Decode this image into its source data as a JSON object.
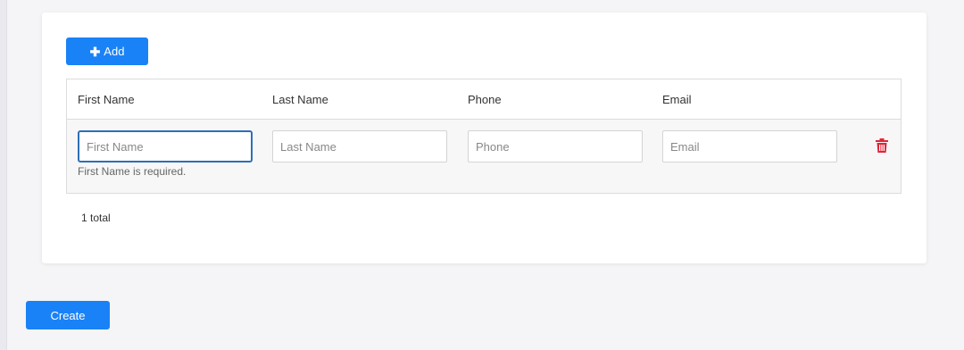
{
  "toolbar": {
    "add_label": "Add"
  },
  "table": {
    "columns": [
      "First Name",
      "Last Name",
      "Phone",
      "Email"
    ],
    "row": {
      "first_name": {
        "value": "",
        "placeholder": "First Name",
        "error": "First Name is required."
      },
      "last_name": {
        "value": "",
        "placeholder": "Last Name"
      },
      "phone": {
        "value": "",
        "placeholder": "Phone"
      },
      "email": {
        "value": "",
        "placeholder": "Email"
      }
    },
    "total": "1 total"
  },
  "footer": {
    "create_label": "Create"
  },
  "colors": {
    "primary": "#1a82f7",
    "danger": "#e0263b",
    "focus_border": "#2d6fb8"
  },
  "icons": {
    "add": "plus-icon",
    "delete": "trash-icon"
  }
}
